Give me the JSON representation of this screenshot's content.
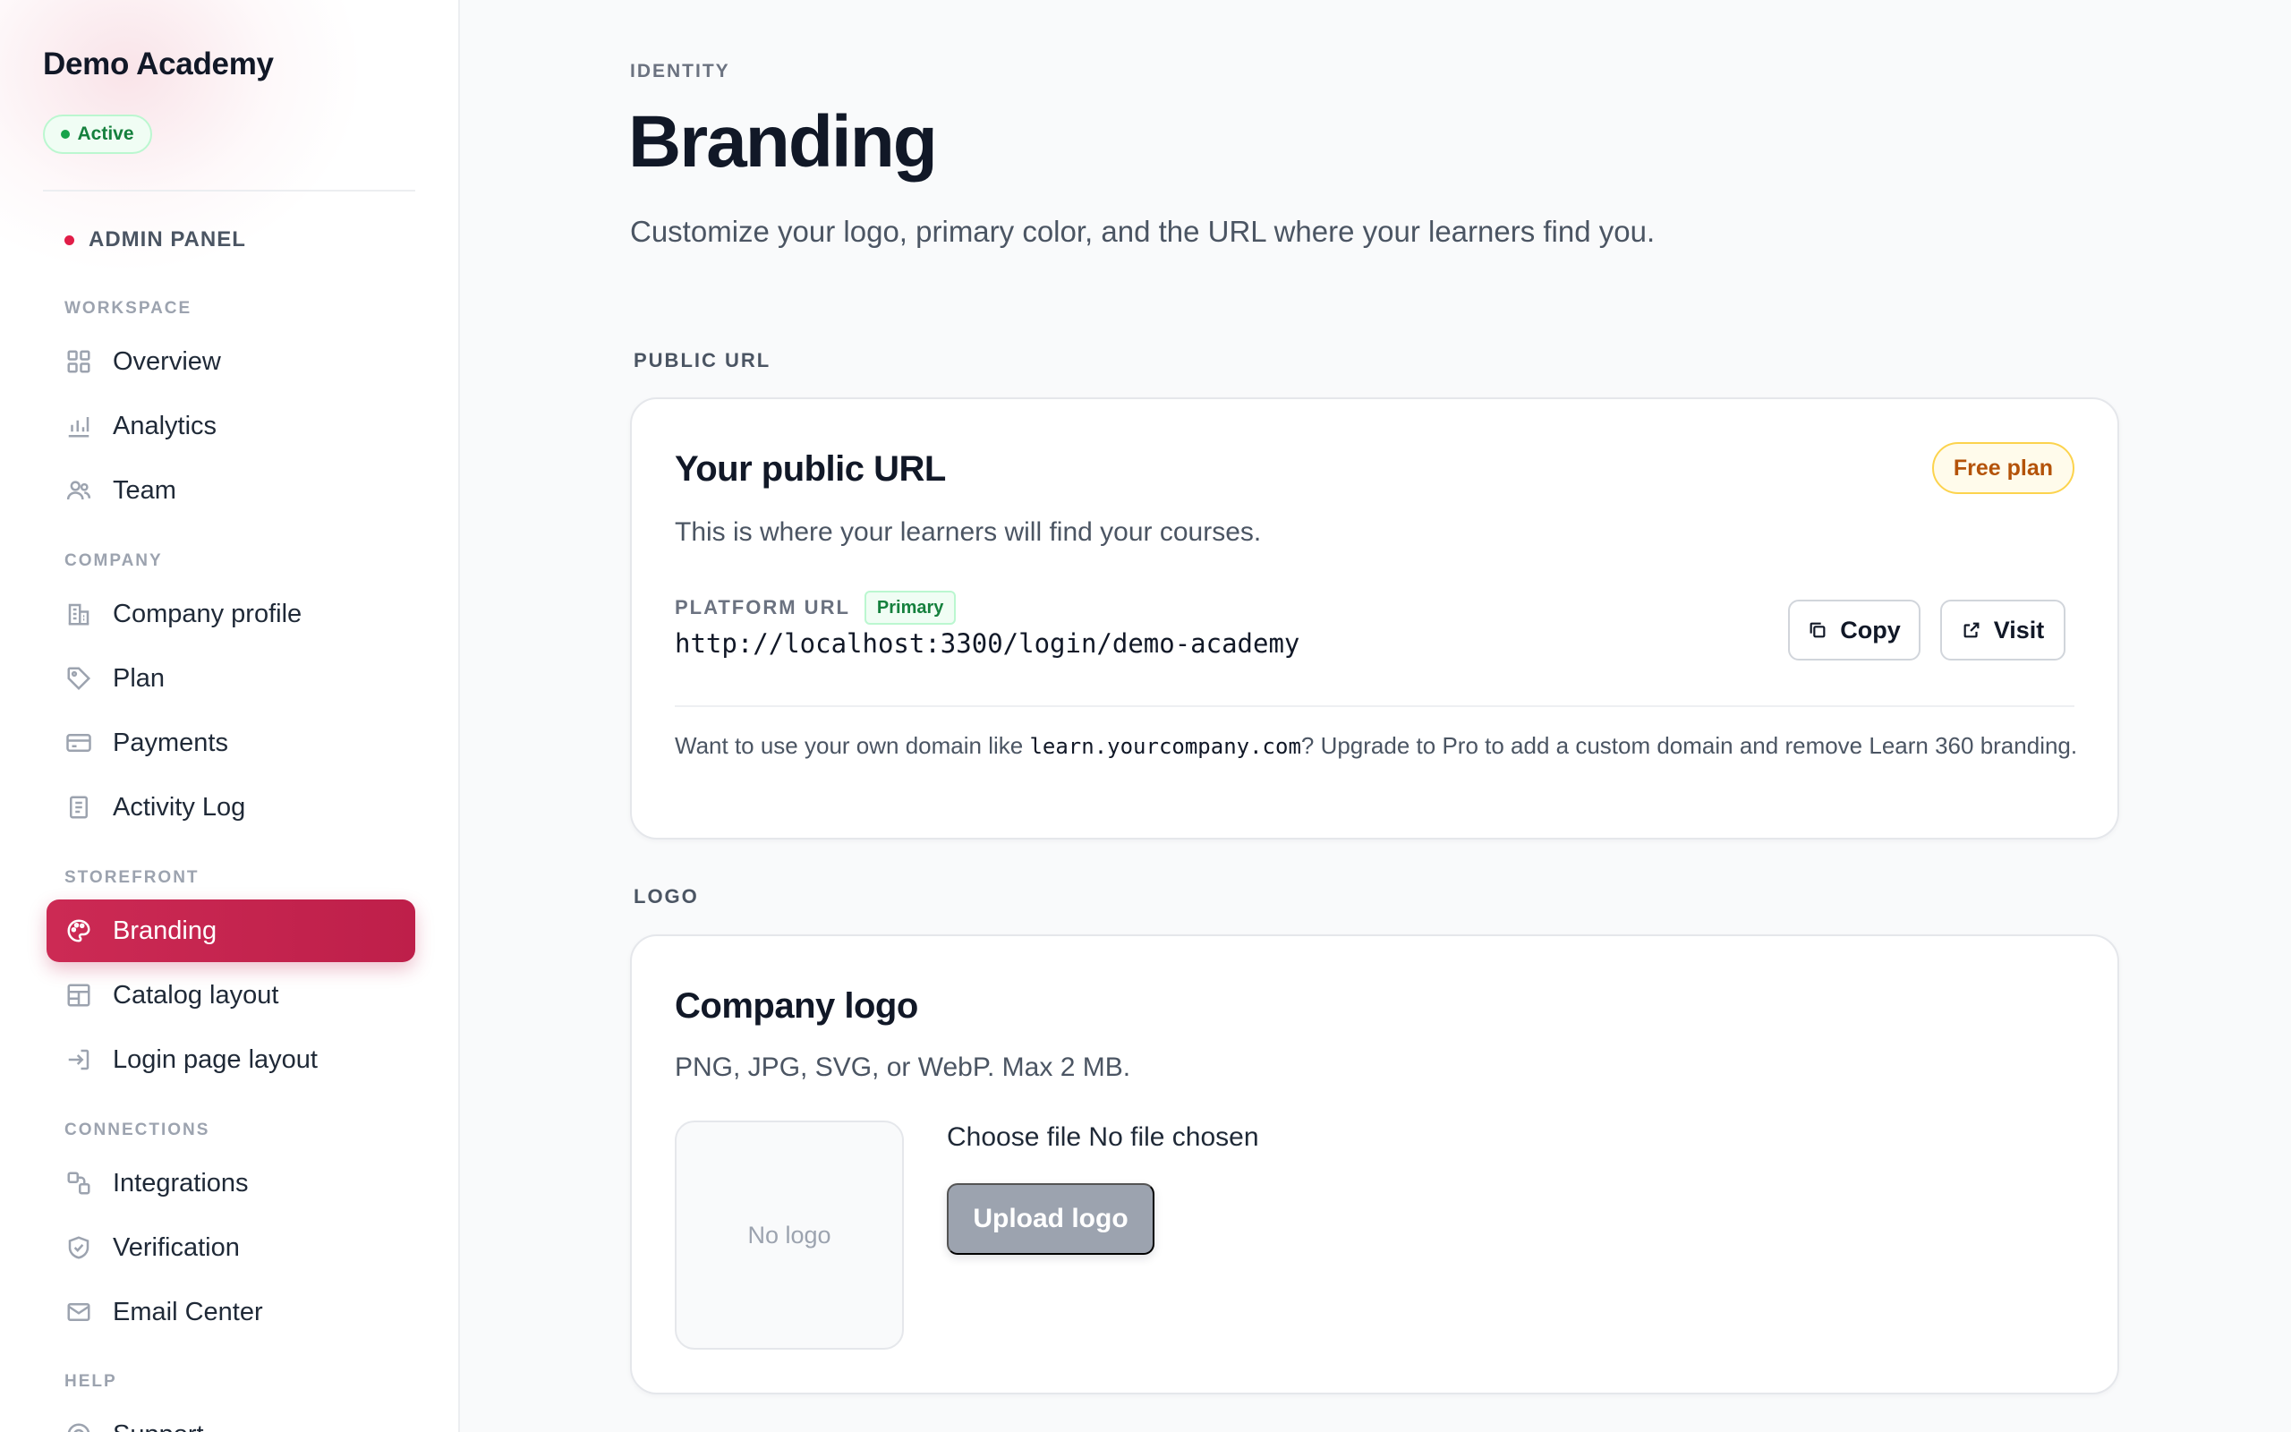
{
  "sidebar": {
    "brand": "Demo Academy",
    "status": "Active",
    "panel_label": "ADMIN PANEL",
    "sections": [
      {
        "label": "WORKSPACE",
        "items": [
          {
            "label": "Overview",
            "icon": "grid-icon"
          },
          {
            "label": "Analytics",
            "icon": "bar-chart-icon"
          },
          {
            "label": "Team",
            "icon": "users-icon"
          }
        ]
      },
      {
        "label": "COMPANY",
        "items": [
          {
            "label": "Company profile",
            "icon": "building-icon"
          },
          {
            "label": "Plan",
            "icon": "tag-icon"
          },
          {
            "label": "Payments",
            "icon": "credit-card-icon"
          },
          {
            "label": "Activity Log",
            "icon": "document-icon"
          }
        ]
      },
      {
        "label": "STOREFRONT",
        "items": [
          {
            "label": "Branding",
            "icon": "palette-icon",
            "active": true
          },
          {
            "label": "Catalog layout",
            "icon": "layout-icon"
          },
          {
            "label": "Login page layout",
            "icon": "login-icon"
          }
        ]
      },
      {
        "label": "CONNECTIONS",
        "items": [
          {
            "label": "Integrations",
            "icon": "integrations-icon"
          },
          {
            "label": "Verification",
            "icon": "shield-check-icon"
          },
          {
            "label": "Email Center",
            "icon": "mail-icon"
          }
        ]
      },
      {
        "label": "HELP",
        "items": [
          {
            "label": "Support",
            "icon": "help-circle-icon"
          }
        ]
      }
    ]
  },
  "header": {
    "eyebrow": "IDENTITY",
    "title": "Branding",
    "subtitle": "Customize your logo, primary color, and the URL where your learners find you."
  },
  "public_url": {
    "section_label": "PUBLIC URL",
    "title": "Your public URL",
    "plan_badge": "Free plan",
    "description": "This is where your learners will find your courses.",
    "url_label": "PLATFORM URL",
    "url_tag": "Primary",
    "url_value": "http://localhost:3300/login/demo-academy",
    "copy_label": "Copy",
    "visit_label": "Visit",
    "note_before": "Want to use your own domain like ",
    "note_domain": "learn.yourcompany.com",
    "note_after": "? Upgrade to Pro to add a custom domain and remove Learn 360 branding."
  },
  "logo": {
    "section_label": "LOGO",
    "title": "Company logo",
    "description": "PNG, JPG, SVG, or WebP. Max 2 MB.",
    "placeholder": "No logo",
    "file_input_text": "Choose file No file chosen",
    "upload_label": "Upload logo"
  },
  "colors": {
    "accent": "#be1f4a",
    "success": "#15803d",
    "warning": "#b45309"
  }
}
